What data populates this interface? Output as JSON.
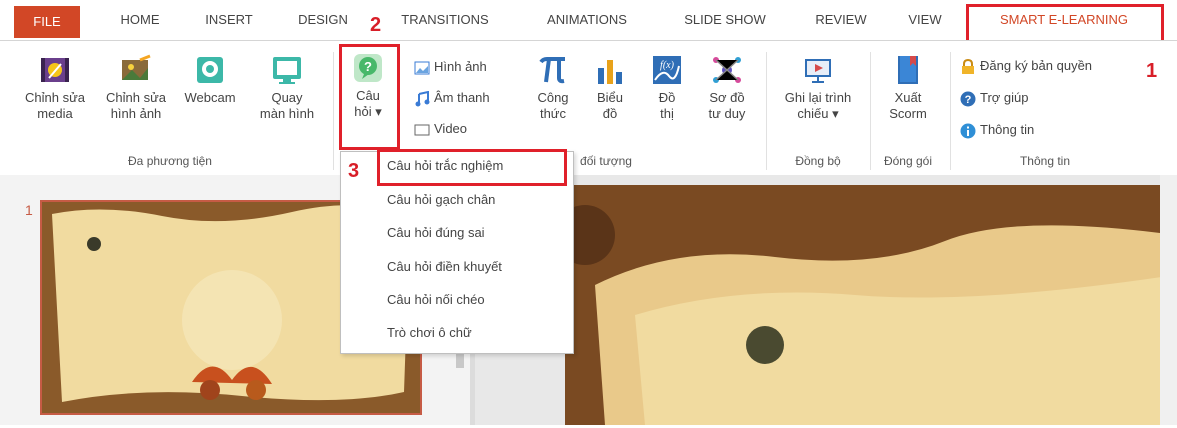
{
  "tabs": [
    {
      "label": "FILE"
    },
    {
      "label": "HOME"
    },
    {
      "label": "INSERT"
    },
    {
      "label": "DESIGN"
    },
    {
      "label": "TRANSITIONS"
    },
    {
      "label": "ANIMATIONS"
    },
    {
      "label": "SLIDE SHOW"
    },
    {
      "label": "REVIEW"
    },
    {
      "label": "VIEW"
    },
    {
      "label": "SMART E-LEARNING"
    }
  ],
  "callouts": {
    "one": "1",
    "two": "2",
    "three": "3"
  },
  "ribbon": {
    "media": {
      "edit_media_l1": "Chỉnh sửa",
      "edit_media_l2": "media",
      "edit_image_l1": "Chỉnh sửa",
      "edit_image_l2": "hình ảnh",
      "webcam": "Webcam",
      "record_l1": "Quay",
      "record_l2": "màn hình",
      "group": "Đa phương tiện"
    },
    "question": {
      "l1": "Câu",
      "l2": "hỏi",
      "arrow": "▾"
    },
    "objects": {
      "image": "Hình ảnh",
      "audio": "Âm thanh",
      "video": "Video",
      "formula_l1": "Công",
      "formula_l2": "thức",
      "chart_l1": "Biểu",
      "chart_l2": "đồ",
      "graph_l1": "Đồ",
      "graph_l2": "thị",
      "mindmap_l1": "Sơ đồ",
      "mindmap_l2": "tư duy",
      "group": "đối tượng"
    },
    "sync": {
      "l1": "Ghi lại trình",
      "l2": "chiếu",
      "arrow": "▾",
      "group": "Đồng bộ"
    },
    "pack": {
      "l1": "Xuất",
      "l2": "Scorm",
      "group": "Đóng gói"
    },
    "info": {
      "license": "Đăng ký bản quyền",
      "help": "Trợ giúp",
      "about": "Thông tin",
      "group": "Thông tin"
    }
  },
  "dropdown": {
    "items": [
      {
        "label": "Câu hỏi trắc nghiệm"
      },
      {
        "label": "Câu hỏi gạch chân"
      },
      {
        "label": "Câu hỏi đúng sai"
      },
      {
        "label": "Câu hỏi điền khuyết"
      },
      {
        "label": "Câu hỏi nối chéo"
      },
      {
        "label": "Trò chơi ô chữ"
      }
    ]
  },
  "slides": {
    "number": "1"
  },
  "colors": {
    "file_tab": "#d24726",
    "highlight": "#e0202a",
    "slide_border": "#c65b45"
  }
}
